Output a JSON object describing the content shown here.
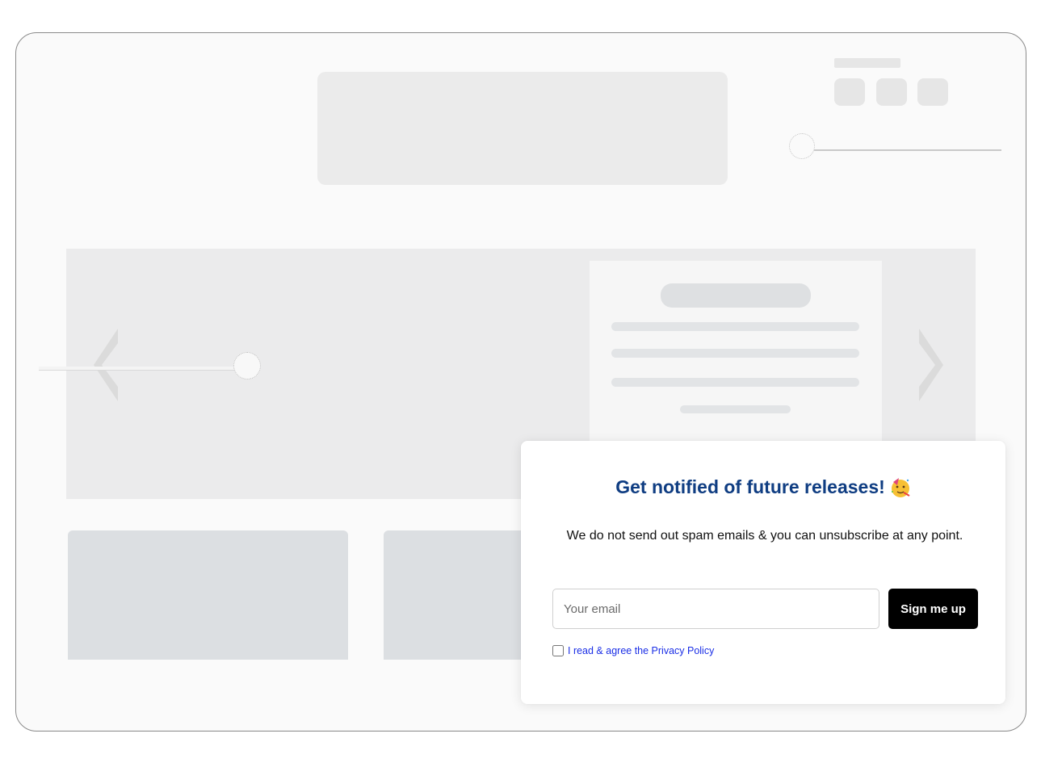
{
  "popup": {
    "title": "Get notified of future releases!",
    "emoji": "partying-face-icon",
    "description": "We do not send out spam emails & you can unsubscribe at any point.",
    "email_placeholder": "Your email",
    "email_value": "",
    "submit_label": "Sign me up",
    "consent_label": "I read & agree the Privacy Policy",
    "consent_checked": false
  },
  "colors": {
    "title": "#0f3d82",
    "button_bg": "#000000",
    "consent_link": "#1a2ee6",
    "skeleton": "#dcdfe2"
  }
}
